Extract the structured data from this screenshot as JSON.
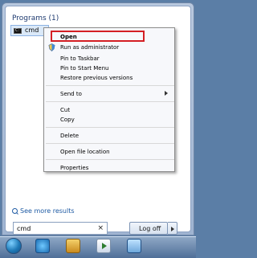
{
  "start_menu": {
    "programs_title": "Programs (1)",
    "program_name": "cmd",
    "see_more_results": "See more results",
    "search_value": "cmd",
    "search_clear": "×",
    "logoff_label": "Log off"
  },
  "context_menu": {
    "items": [
      {
        "label": "Open",
        "y": 0
      },
      {
        "label": "Run as administrator",
        "y": 1
      },
      {
        "label": "Pin to Taskbar",
        "y": 2
      },
      {
        "label": "Pin to Start Menu",
        "y": 3
      },
      {
        "label": "Restore previous versions",
        "y": 4
      },
      {
        "label": "Send to",
        "y": 5
      },
      {
        "label": "Cut",
        "y": 6
      },
      {
        "label": "Copy",
        "y": 7
      },
      {
        "label": "Delete",
        "y": 8
      },
      {
        "label": "Open file location",
        "y": 9
      },
      {
        "label": "Properties",
        "y": 10
      }
    ]
  },
  "taskbar": {
    "icons": [
      "start-orb",
      "internet-explorer-icon",
      "windows-explorer-icon",
      "media-player-icon",
      "command-prompt-icon"
    ]
  },
  "colors": {
    "highlight": "#d41f24",
    "selection": "#dbe9f8",
    "link": "#1e5aa3"
  }
}
